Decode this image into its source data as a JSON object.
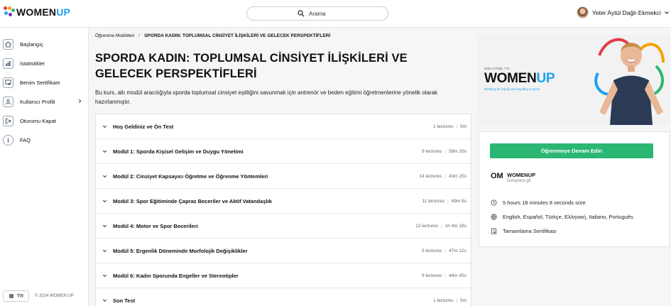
{
  "brand": {
    "name_main": "WOMEN",
    "name_accent": "UP",
    "colors": {
      "accent": "#1da1f2",
      "cta": "#2bb673"
    }
  },
  "search": {
    "placeholder": "Arama"
  },
  "user": {
    "name": "Yeter Aytül Dağlı Ekmekci"
  },
  "sidebar": {
    "items": [
      {
        "label": "Başlangıç",
        "icon": "home-icon"
      },
      {
        "label": "İstatistikler",
        "icon": "chart-icon"
      },
      {
        "label": "Benim Sertifikam",
        "icon": "certificate-icon"
      },
      {
        "label": "Kullanıcı Profili",
        "icon": "user-icon"
      },
      {
        "label": "Oturumu Kapat",
        "icon": "logout-icon"
      },
      {
        "label": "FAQ",
        "icon": "info-icon"
      }
    ],
    "language": "TR",
    "copyright": "© 2024 WOMEN UP"
  },
  "breadcrumb": {
    "parent": "Öğrenme Modülleri",
    "separator": "/",
    "current": "SPORDA KADIN: TOPLUMSAL CİNSİYET İLİŞKİLERİ VE GELECEK PERSPEKTİFLERİ"
  },
  "course": {
    "title": "SPORDA KADIN: TOPLUMSAL CİNSİYET İLİŞKİLERİ VE GELECEK PERSPEKTİFLERİ",
    "description": "Bu kurs, altı modül aracılığıyla sporda toplumsal cinsiyet eşitliğini savunmak için antrenör ve beden eğitimi öğretmenlerine yönelik olarak hazırlanmıştır."
  },
  "modules": [
    {
      "title": "Hoş Geldiniz ve Ön Test",
      "lectures": "1 lectures",
      "duration": "5m"
    },
    {
      "title": "Modül 1: Sporda Kişisel Gelişim ve Duygu Yönetimi",
      "lectures": "9 lectures",
      "duration": "59m 20s"
    },
    {
      "title": "Modül 2: Cinsiyet Kapsayıcı Öğretme ve Öğrenme Yöntemleri",
      "lectures": "14 lectures",
      "duration": "43m 25s"
    },
    {
      "title": "Modül 3: Spor Eğitiminde Çapraz Beceriler ve Aktif Vatandaşlık",
      "lectures": "11 lectures",
      "duration": "49m 8s"
    },
    {
      "title": "Modül 4: Motor ve Spor Becerileri",
      "lectures": "13 lectures",
      "duration": "1h 4m 18s"
    },
    {
      "title": "Modül 5: Ergenlik Döneminde Morfolojik Değişiklikler",
      "lectures": "9 lectures",
      "duration": "47m 12s"
    },
    {
      "title": "Modül 6: Kadın Sporunda Engeller ve Stereotipler",
      "lectures": "9 lectures",
      "duration": "44m 45s"
    },
    {
      "title": "Son Test",
      "lectures": "1 lectures",
      "duration": "5m"
    }
  ],
  "meta_separator": "|",
  "hero": {
    "welcome": "WELCOME TO",
    "logo_main": "WOMEN",
    "logo_accent": "UP",
    "tagline": "Working for equity and equality in sport"
  },
  "panel": {
    "cta_label": "Öğrenmeye Devam Edin",
    "org_logo": "OM",
    "org_name": "WOMENUP",
    "org_link": "Detaylara git",
    "duration": "5 hours 18 minutes 8 seconds süre",
    "languages": "English, Español, Türkçe, Ελληνική, Italiano, Português",
    "certificate": "Tamamlama Sertifikası"
  }
}
